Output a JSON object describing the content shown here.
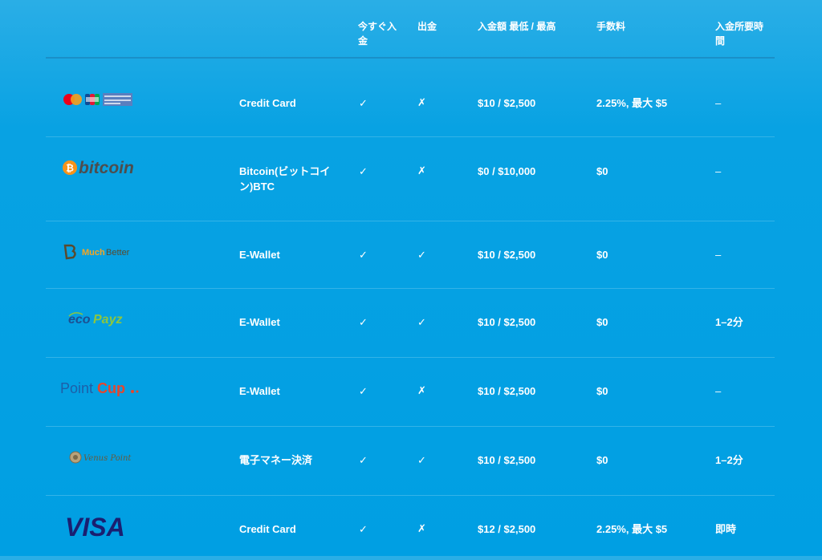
{
  "header": {
    "col_deposit": "今すぐ入金",
    "col_withdraw": "出金",
    "col_limits": "入金額 最低 / 最高",
    "col_fee": "手数料",
    "col_time": "入金所要時間"
  },
  "rows": [
    {
      "logo": "card-brands-logo",
      "method": "Credit Card",
      "deposit": "✓",
      "withdraw": "✗",
      "limits": "$10 / $2,500",
      "fee": "2.25%, 最大 $5",
      "time": "–"
    },
    {
      "logo": "bitcoin-logo",
      "logo_text": "bitcoin",
      "method": "Bitcoin(ビットコイン)BTC",
      "deposit": "✓",
      "withdraw": "✗",
      "limits": "$0 / $10,000",
      "fee": "$0",
      "time": "–"
    },
    {
      "logo": "muchbetter-logo",
      "logo_text_1": "Much",
      "logo_text_2": "Better",
      "method": "E-Wallet",
      "deposit": "✓",
      "withdraw": "✓",
      "limits": "$10 / $2,500",
      "fee": "$0",
      "time": "–"
    },
    {
      "logo": "ecopayz-logo",
      "logo_text_1": "eco",
      "logo_text_2": "Payz",
      "method": "E-Wallet",
      "deposit": "✓",
      "withdraw": "✓",
      "limits": "$10 / $2,500",
      "fee": "$0",
      "time": "1–2分"
    },
    {
      "logo": "pointcup-logo",
      "logo_text_1": "Point",
      "logo_text_2": "Cup",
      "method": "E-Wallet",
      "deposit": "✓",
      "withdraw": "✗",
      "limits": "$10 / $2,500",
      "fee": "$0",
      "time": "–"
    },
    {
      "logo": "venuspoint-logo",
      "logo_text": "Venus Point",
      "method": "電子マネー決済",
      "deposit": "✓",
      "withdraw": "✓",
      "limits": "$10 / $2,500",
      "fee": "$0",
      "time": "1–2分"
    },
    {
      "logo": "visa-logo",
      "logo_text": "VISA",
      "method": "Credit Card",
      "deposit": "✓",
      "withdraw": "✗",
      "limits": "$12 / $2,500",
      "fee": "2.25%, 最大 $5",
      "time": "即時"
    }
  ],
  "colors": {
    "bg_top": "#2aaee6",
    "bg": "#009fe3",
    "row_border": "#33b3e8",
    "visa_blue": "#1a1f71",
    "bitcoin_orange": "#f7931a",
    "ecopayz_green": "#8cc63f",
    "pointcup_red": "#e8452c"
  }
}
